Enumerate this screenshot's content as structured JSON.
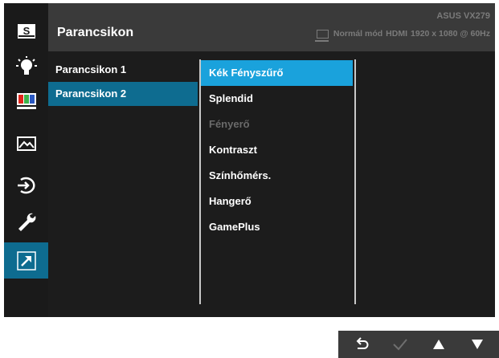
{
  "header": {
    "title": "Parancsikon",
    "model": "ASUS VX279",
    "mode": "Normál mód",
    "input": "HDMI",
    "resolution": "1920 x 1080 @ 60Hz"
  },
  "sidebar": {
    "items": [
      {
        "name": "splendid",
        "icon": "s-box-icon"
      },
      {
        "name": "blue-light-filter",
        "icon": "bulb-icon"
      },
      {
        "name": "color",
        "icon": "color-bars-icon"
      },
      {
        "name": "image",
        "icon": "mountain-image-icon"
      },
      {
        "name": "input-select",
        "icon": "input-arrow-icon"
      },
      {
        "name": "system-setup",
        "icon": "wrench-icon"
      },
      {
        "name": "shortcut",
        "icon": "shortcut-arrow-icon",
        "active": true
      }
    ]
  },
  "menu_level1": [
    {
      "label": "Parancsikon 1"
    },
    {
      "label": "Parancsikon 2",
      "active": true
    }
  ],
  "menu_level2": [
    {
      "label": "Kék Fényszűrő",
      "active": true
    },
    {
      "label": "Splendid"
    },
    {
      "label": "Fényerő",
      "disabled": true
    },
    {
      "label": "Kontraszt"
    },
    {
      "label": "Színhőmérs."
    },
    {
      "label": "Hangerő"
    },
    {
      "label": "GamePlus"
    }
  ],
  "navigation": {
    "buttons": [
      {
        "name": "back",
        "icon": "back-arrow-icon"
      },
      {
        "name": "confirm",
        "icon": "checkmark-icon",
        "disabled": true
      },
      {
        "name": "up",
        "icon": "triangle-up-icon"
      },
      {
        "name": "down",
        "icon": "triangle-down-icon"
      }
    ]
  },
  "colors": {
    "accent_active": "#1aa2dc",
    "accent_selected": "#0e6c90",
    "panel": "#1c1c1c",
    "header": "#3a3a3a"
  }
}
